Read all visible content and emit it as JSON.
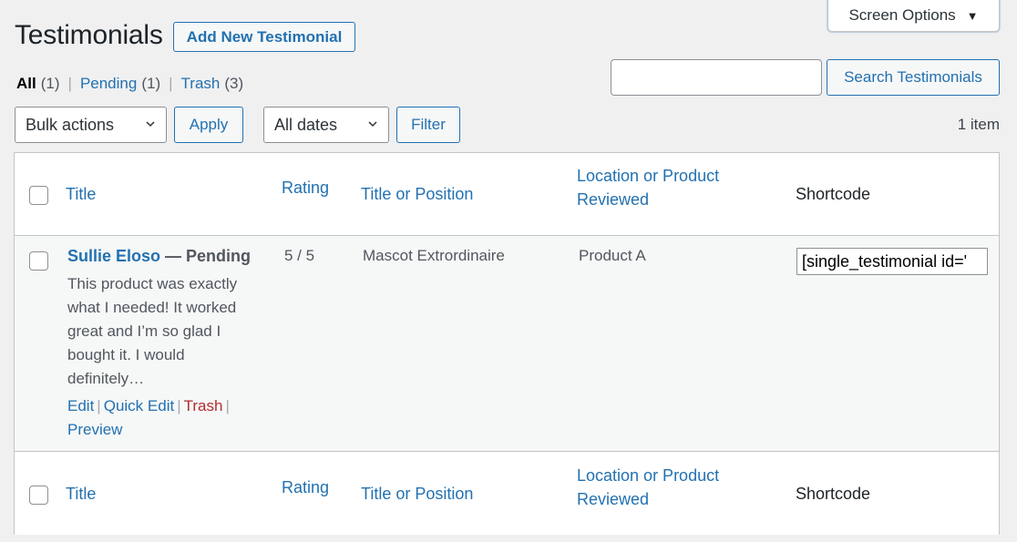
{
  "screen_options": {
    "label": "Screen Options",
    "icon": "triangle-down-icon"
  },
  "header": {
    "title": "Testimonials",
    "add_new_label": "Add New Testimonial"
  },
  "views": [
    {
      "label": "All",
      "count": "(1)",
      "current": true
    },
    {
      "label": "Pending",
      "count": "(1)",
      "current": false
    },
    {
      "label": "Trash",
      "count": "(3)",
      "current": false
    }
  ],
  "search": {
    "value": "",
    "placeholder": "",
    "button_label": "Search Testimonials"
  },
  "tablenav": {
    "bulk_actions": {
      "selected": "Bulk actions"
    },
    "apply_label": "Apply",
    "dates": {
      "selected": "All dates"
    },
    "filter_label": "Filter",
    "items_count": "1 item"
  },
  "table": {
    "columns": [
      {
        "label": "Title",
        "sortable": true
      },
      {
        "label": "Rating",
        "sortable": true
      },
      {
        "label": "Title or Position",
        "sortable": true
      },
      {
        "label": "Location or Product Reviewed",
        "label_line1": "Location or Product",
        "label_line2": "Reviewed",
        "sortable": true
      },
      {
        "label": "Shortcode",
        "sortable": false
      }
    ],
    "rows": [
      {
        "title": "Sullie Eloso",
        "state": " — Pending",
        "excerpt": "This product was exactly what I needed! It worked great and I’m so glad I bought it. I would definitely…",
        "rating": "5 / 5",
        "position": "Mascot Extrordinaire",
        "location": "Product A",
        "shortcode": "[single_testimonial id='",
        "actions": {
          "edit": "Edit",
          "quick_edit": "Quick Edit",
          "trash": "Trash",
          "preview": "Preview"
        }
      }
    ]
  },
  "colors": {
    "link": "#2271b1",
    "trash": "#b32d2e",
    "background": "#f0f0f1",
    "row_alt": "#f6f7f7"
  }
}
